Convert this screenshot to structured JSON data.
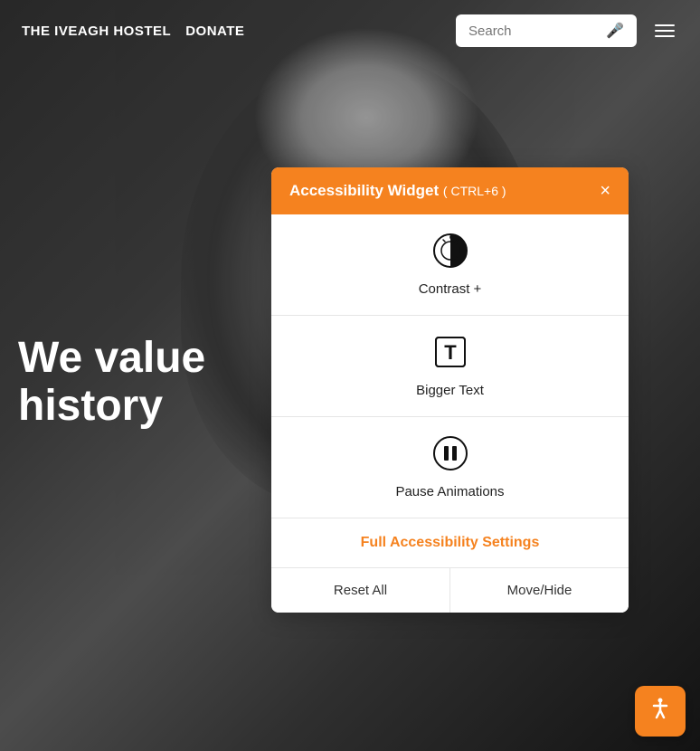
{
  "site": {
    "title": "THE IVEAGH HOSTEL",
    "donate_label": "DONATE"
  },
  "navbar": {
    "search_placeholder": "Search",
    "search_value": ""
  },
  "hero": {
    "line1": "We value",
    "line2": "history"
  },
  "widget": {
    "title": "Accessibility Widget",
    "shortcut": "( CTRL+6 )",
    "close_label": "×",
    "items": [
      {
        "id": "contrast",
        "label": "Contrast +"
      },
      {
        "id": "bigger-text",
        "label": "Bigger Text"
      },
      {
        "id": "pause-animations",
        "label": "Pause Animations"
      }
    ],
    "full_settings_label": "Full Accessibility Settings",
    "reset_label": "Reset All",
    "move_hide_label": "Move/Hide"
  },
  "fab": {
    "aria_label": "Accessibility"
  },
  "colors": {
    "orange": "#f5821f",
    "white": "#ffffff"
  }
}
